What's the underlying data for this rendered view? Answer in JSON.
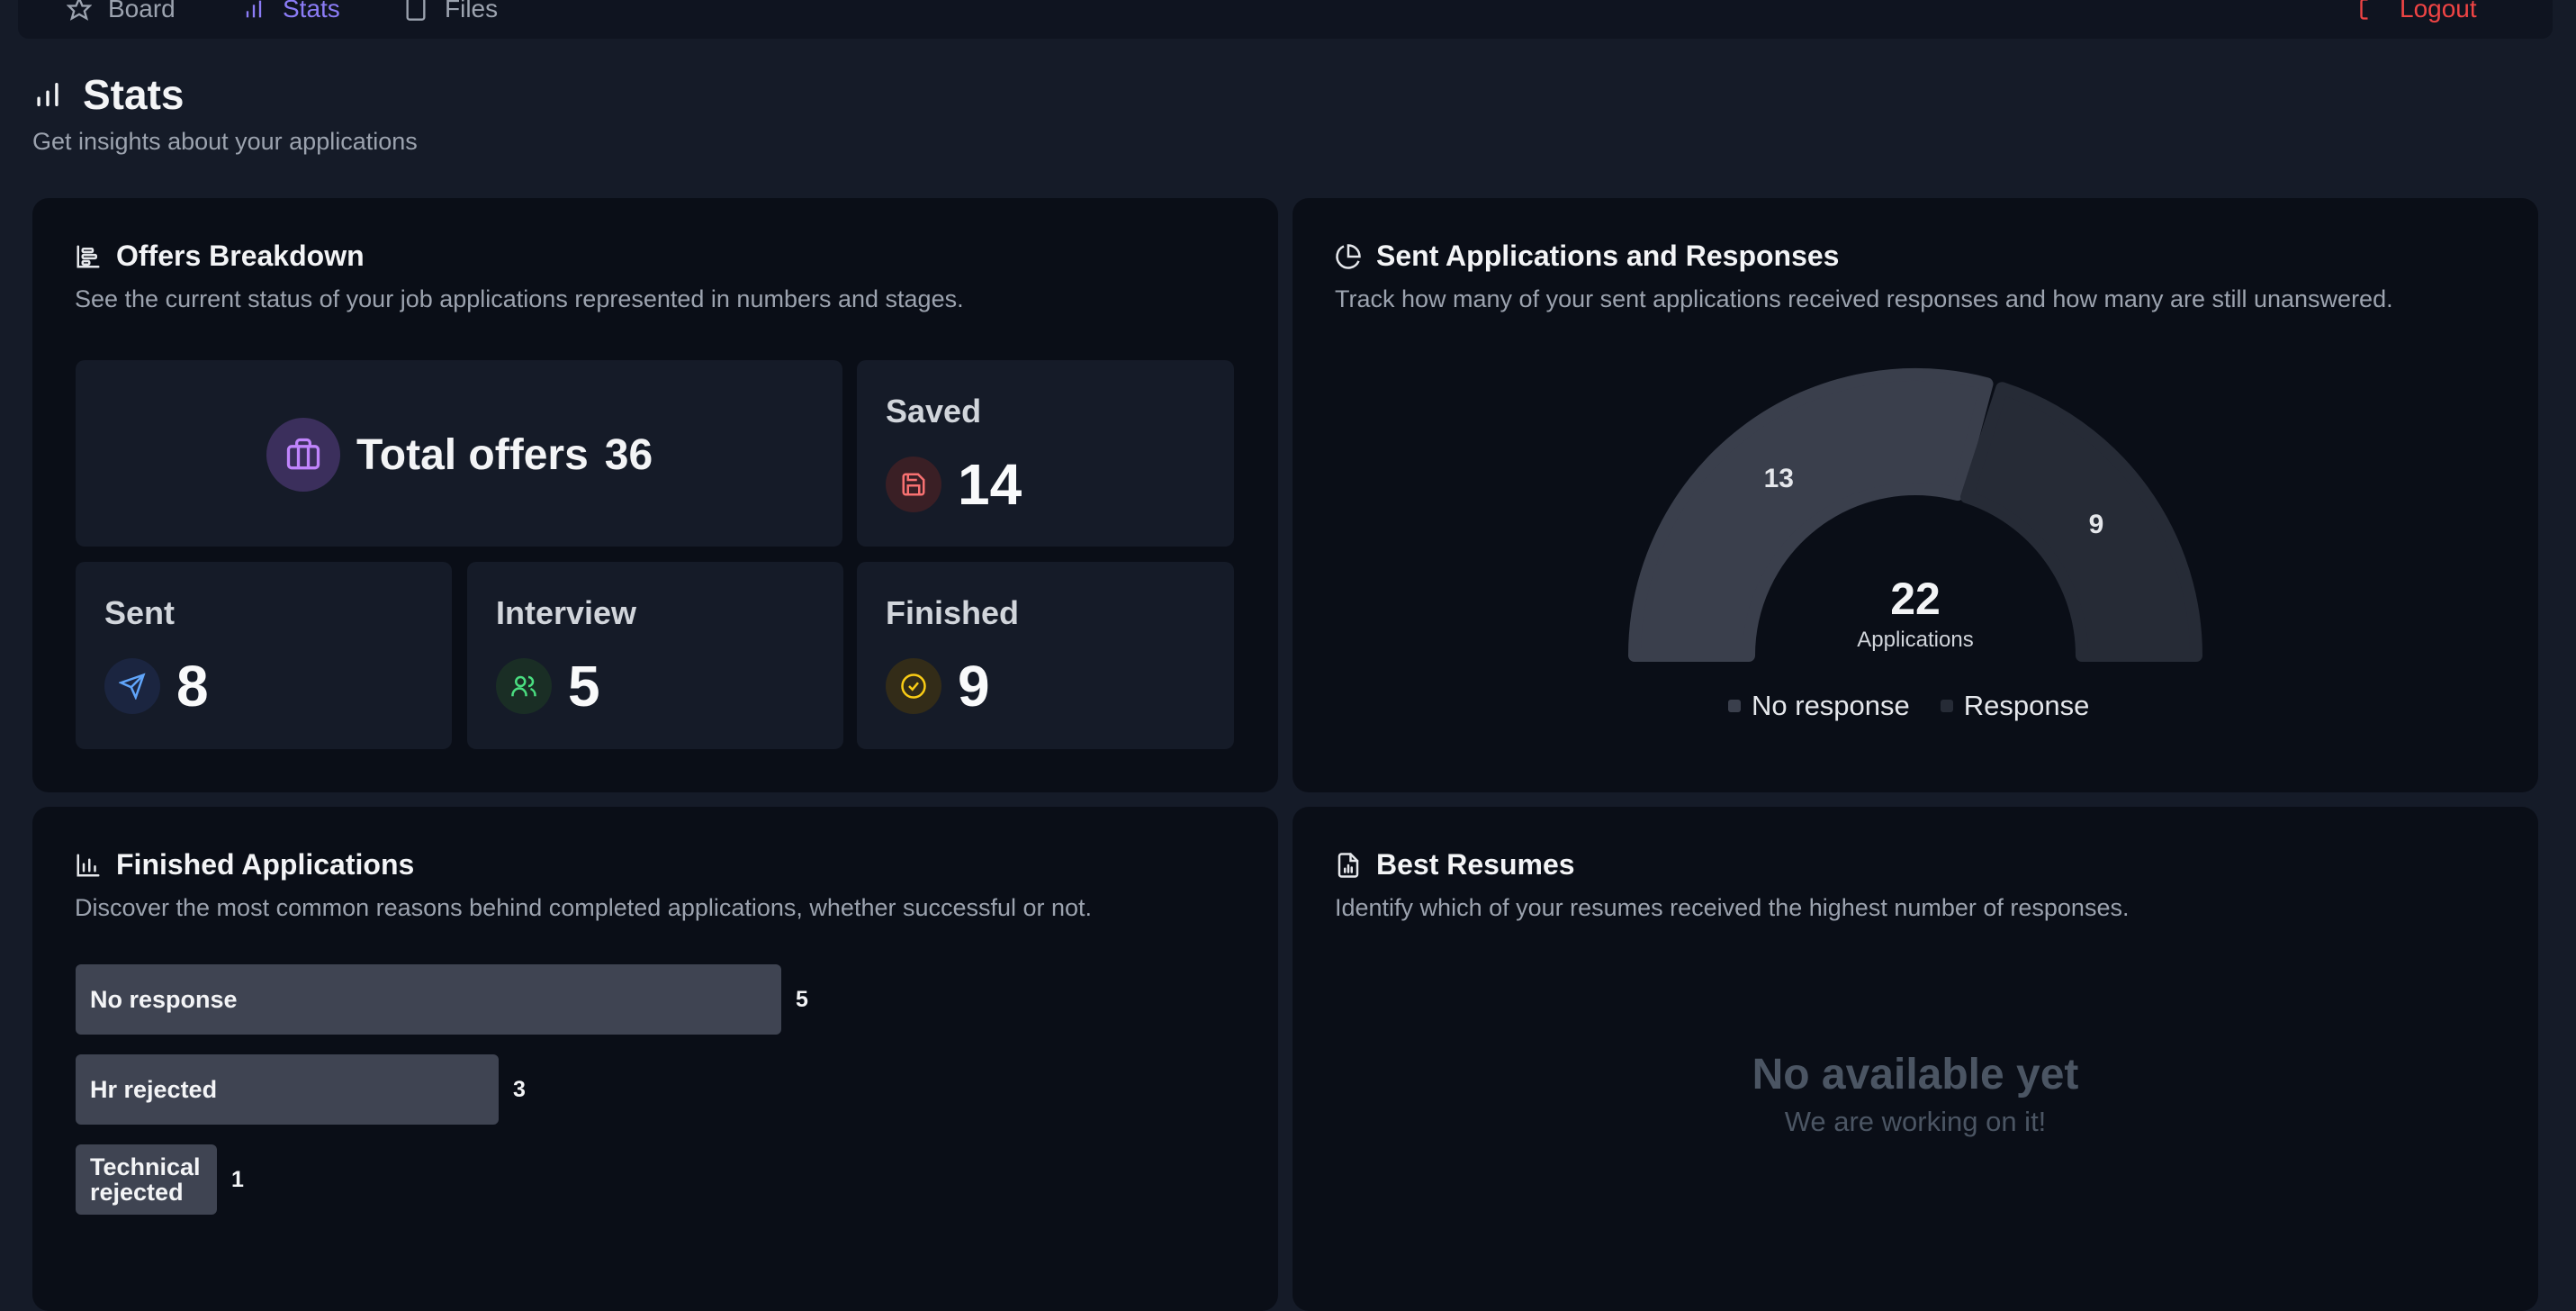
{
  "nav": {
    "items": [
      {
        "label": "Board",
        "icon": "star-icon"
      },
      {
        "label": "Stats",
        "icon": "bar-chart-icon",
        "active": true
      },
      {
        "label": "Files",
        "icon": "file-icon"
      }
    ],
    "logout_label": "Logout"
  },
  "page": {
    "title": "Stats",
    "subtitle": "Get insights about your applications"
  },
  "offers": {
    "title": "Offers Breakdown",
    "description": "See the current status of your job applications represented in numbers and stages.",
    "total_label": "Total offers",
    "total_value": "36",
    "saved_label": "Saved",
    "saved_value": "14",
    "sent_label": "Sent",
    "sent_value": "8",
    "interview_label": "Interview",
    "interview_value": "5",
    "finished_label": "Finished",
    "finished_value": "9"
  },
  "responses": {
    "title": "Sent Applications and Responses",
    "description": "Track how many of your sent applications received responses and how many are still unanswered.",
    "center_value": "22",
    "center_label": "Applications"
  },
  "finished_apps": {
    "title": "Finished Applications",
    "description": "Discover the most common reasons behind completed applications, whether successful or not."
  },
  "resumes": {
    "title": "Best Resumes",
    "description": "Identify which of your resumes received the highest number of responses.",
    "empty_title": "No available yet",
    "empty_subtitle": "We are working on it!"
  },
  "colors": {
    "accent": "#8b7cf6",
    "danger": "#ef4444",
    "no_response": "#3a3f4c",
    "response": "#262b36",
    "bar": "#3f4452"
  },
  "chart_data": [
    {
      "type": "pie",
      "labels": [
        "No response",
        "Response"
      ],
      "values": [
        13,
        9
      ],
      "total": 22
    },
    {
      "type": "bar",
      "categories": [
        "No response",
        "Hr rejected",
        "Technical rejected"
      ],
      "values": [
        5,
        3,
        1
      ]
    }
  ]
}
